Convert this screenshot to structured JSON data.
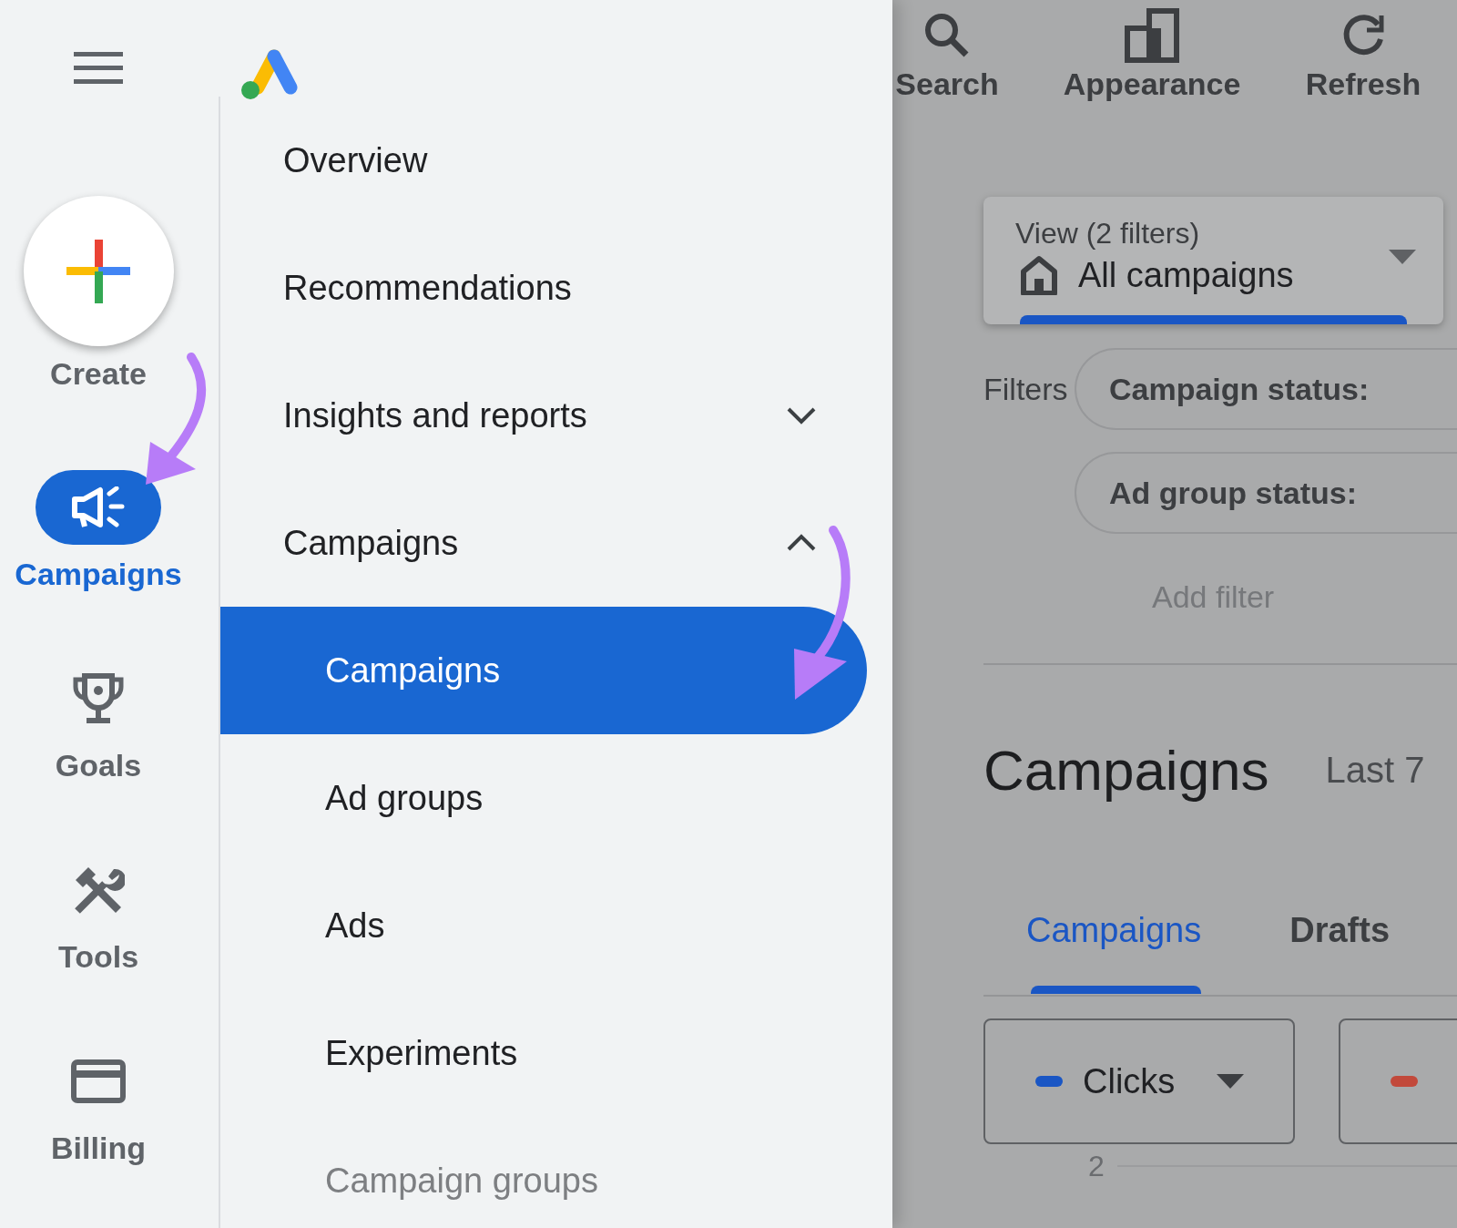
{
  "rail": {
    "items": [
      {
        "kind": "create",
        "label": "Create"
      },
      {
        "kind": "nav",
        "label": "Campaigns",
        "selected": true
      },
      {
        "kind": "nav",
        "label": "Goals",
        "selected": false
      },
      {
        "kind": "nav",
        "label": "Tools",
        "selected": false
      },
      {
        "kind": "nav",
        "label": "Billing",
        "selected": false
      }
    ]
  },
  "menu": {
    "items": [
      {
        "label": "Overview"
      },
      {
        "label": "Recommendations"
      },
      {
        "label": "Insights and reports",
        "expanded": false
      },
      {
        "label": "Campaigns",
        "expanded": true,
        "children": [
          {
            "label": "Campaigns",
            "selected": true
          },
          {
            "label": "Ad groups",
            "selected": false
          },
          {
            "label": "Ads",
            "selected": false
          },
          {
            "label": "Experiments",
            "selected": false
          },
          {
            "label": "Campaign groups",
            "selected": false
          }
        ]
      }
    ]
  },
  "toolbar": [
    "Search",
    "Appearance",
    "Refresh"
  ],
  "view": {
    "label": "View (2 filters)",
    "value": "All campaigns"
  },
  "filters": {
    "label": "Filters",
    "chips": [
      "Campaign status:",
      "Ad group status:"
    ],
    "add": "Add filter"
  },
  "heading": {
    "title": "Campaigns",
    "range": "Last 7"
  },
  "tabs": [
    {
      "label": "Campaigns",
      "selected": true
    },
    {
      "label": "Drafts",
      "selected": false
    }
  ],
  "metrics": [
    {
      "label": "Clicks",
      "color": "#1a56c4"
    },
    {
      "color": "#c2493b"
    }
  ],
  "axis_tick": "2"
}
